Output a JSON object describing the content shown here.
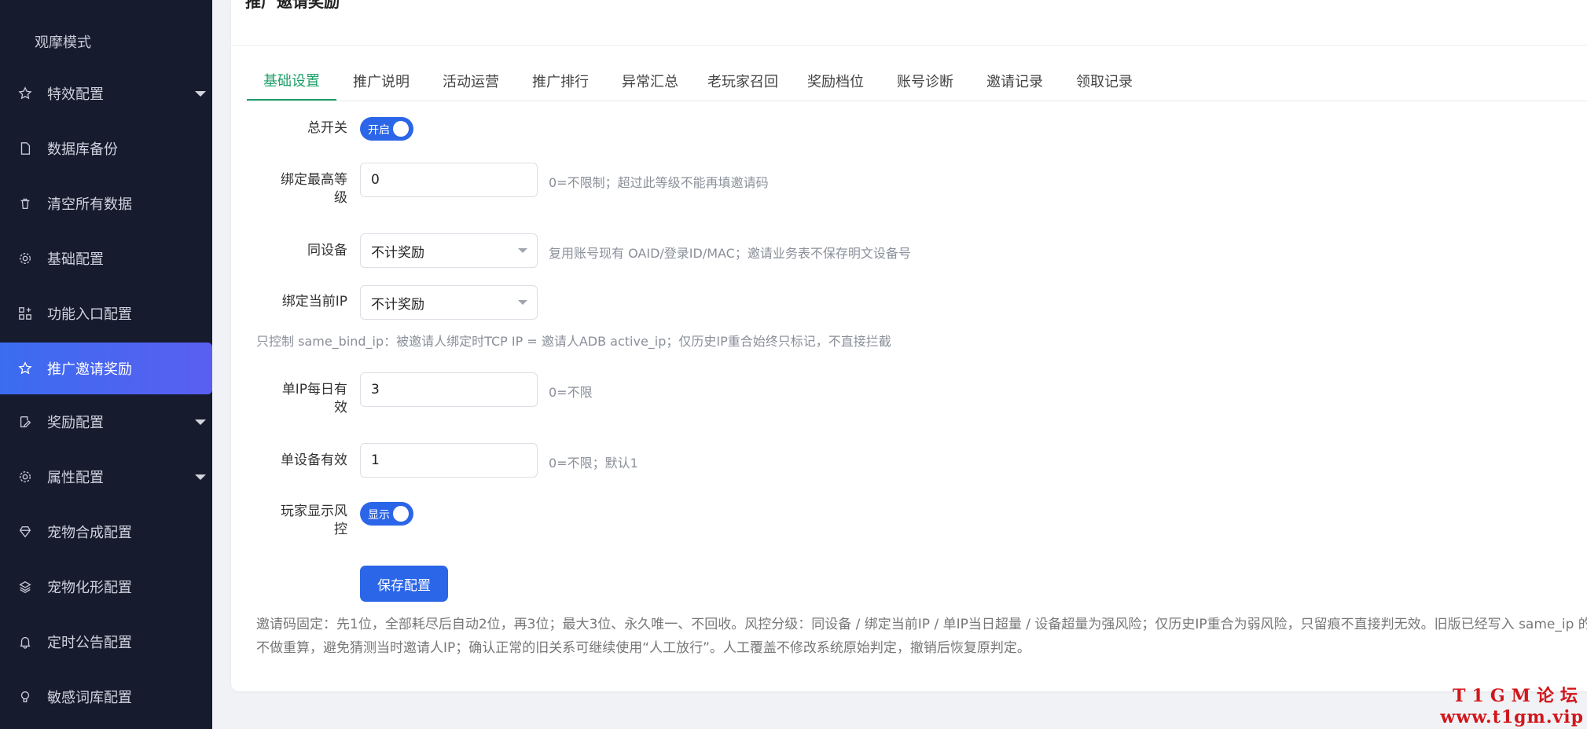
{
  "sidebar": {
    "mode_label": "观摩模式",
    "items": [
      {
        "label": "特效配置",
        "icon": "star-icon",
        "has_caret": true
      },
      {
        "label": "数据库备份",
        "icon": "file-icon",
        "has_caret": false
      },
      {
        "label": "清空所有数据",
        "icon": "trash-icon",
        "has_caret": false
      },
      {
        "label": "基础配置",
        "icon": "gear-icon",
        "has_caret": false
      },
      {
        "label": "功能入口配置",
        "icon": "grid-plus-icon",
        "has_caret": false
      },
      {
        "label": "推广邀请奖励",
        "icon": "star-icon",
        "has_caret": false,
        "active": true
      },
      {
        "label": "奖励配置",
        "icon": "edit-doc-icon",
        "has_caret": true
      },
      {
        "label": "属性配置",
        "icon": "gear-icon",
        "has_caret": true
      },
      {
        "label": "宠物合成配置",
        "icon": "gem-icon",
        "has_caret": false
      },
      {
        "label": "宠物化形配置",
        "icon": "layers-icon",
        "has_caret": false
      },
      {
        "label": "定时公告配置",
        "icon": "bell-icon",
        "has_caret": false
      },
      {
        "label": "敏感词库配置",
        "icon": "bulb-icon",
        "has_caret": false
      }
    ]
  },
  "panel": {
    "title": "推广邀请奖励"
  },
  "tabs": [
    {
      "label": "基础设置",
      "active": true
    },
    {
      "label": "推广说明"
    },
    {
      "label": "活动运营"
    },
    {
      "label": "推广排行"
    },
    {
      "label": "异常汇总"
    },
    {
      "label": "老玩家召回"
    },
    {
      "label": "奖励档位"
    },
    {
      "label": "账号诊断"
    },
    {
      "label": "邀请记录"
    },
    {
      "label": "领取记录"
    }
  ],
  "form": {
    "master_switch": {
      "label": "总开关",
      "state_text": "开启"
    },
    "max_bind_level": {
      "label_line1": "绑定最高等",
      "label_line2": "级",
      "value": "0",
      "hint": "0=不限制；超过此等级不能再填邀请码"
    },
    "same_device": {
      "label": "同设备",
      "value": "不计奖励",
      "hint": "复用账号现有 OAID/登录ID/MAC；邀请业务表不保存明文设备号"
    },
    "bind_current_ip": {
      "label": "绑定当前IP",
      "value": "不计奖励"
    },
    "ip_note": "只控制 same_bind_ip：被邀请人绑定时TCP IP = 邀请人ADB active_ip；仅历史IP重合始终只标记，不直接拦截",
    "per_ip_daily": {
      "label_line1": "单IP每日有",
      "label_line2": "效",
      "value": "3",
      "hint": "0=不限"
    },
    "per_device": {
      "label": "单设备有效",
      "value": "1",
      "hint": "0=不限；默认1"
    },
    "player_risk": {
      "label_line1": "玩家显示风",
      "label_line2": "控",
      "state_text": "显示"
    },
    "save_label": "保存配置"
  },
  "footnote": "邀请码固定：先1位，全部耗尽后自动2位，再3位；最大3位、永久唯一、不回收。风控分级：同设备 / 绑定当前IP / 单IP当日超量 / 设备超量为强风险；仅历史IP重合为弱风险，只留痕不直接判无效。旧版已经写入 same_ip 的关系不做重算，避免猜测当时邀请人IP；确认正常的旧关系可继续使用“人工放行”。人工覆盖不修改系统原始判定，撤销后恢复原判定。",
  "watermark": {
    "line1": "T1GM论坛",
    "line2": "www.t1gm.vip"
  },
  "colors": {
    "accent": "#2c66e8",
    "tab_active": "#1e9e6a",
    "sidebar_bg": "#161b2e"
  }
}
